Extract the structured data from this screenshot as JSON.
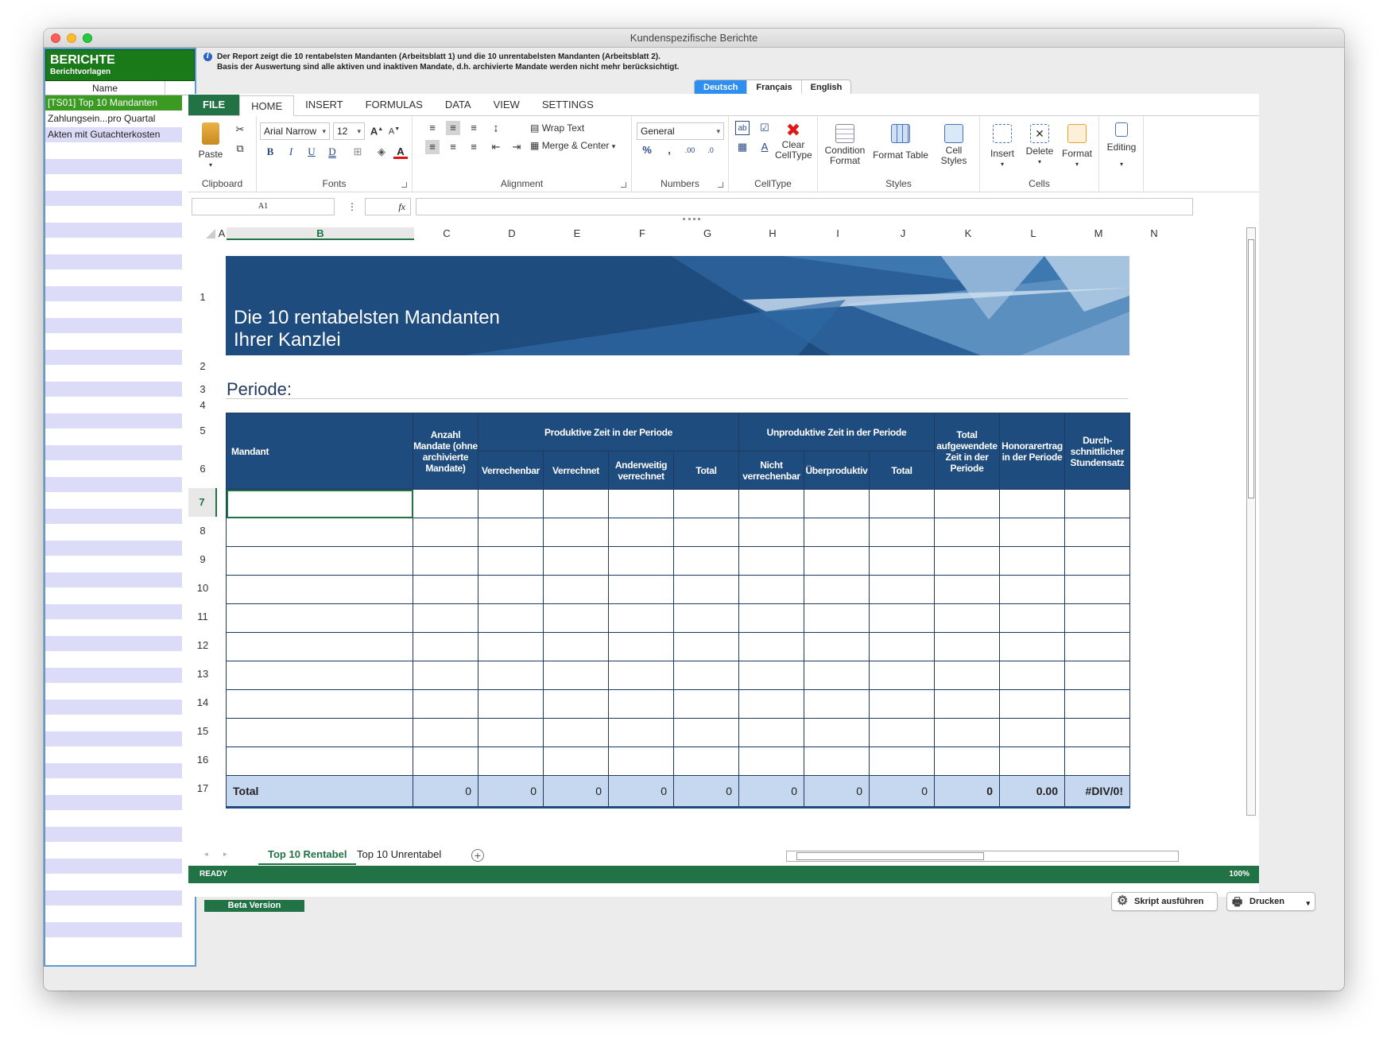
{
  "window": {
    "title": "Kundenspezifische Berichte"
  },
  "sidebar": {
    "title": "BERICHTE",
    "subtitle": "Berichtvorlagen",
    "column": "Name",
    "items": [
      "[TS01] Top 10 Mandanten",
      "Zahlungsein...pro Quartal",
      "Akten mit Gutachterkosten"
    ]
  },
  "info": {
    "line1": "Der Report zeigt die 10 rentabelsten Mandanten (Arbeitsblatt 1) und die 10 unrentabelsten Mandanten (Arbeitsblatt 2).",
    "line2": "Basis der Auswertung sind alle aktiven und inaktiven Mandate, d.h. archivierte Mandate werden nicht mehr berücksichtigt."
  },
  "languages": [
    "Deutsch",
    "Français",
    "English"
  ],
  "ribbon": {
    "tabs": [
      "FILE",
      "HOME",
      "INSERT",
      "FORMULAS",
      "DATA",
      "VIEW",
      "SETTINGS"
    ],
    "groups": {
      "clipboard": "Clipboard",
      "fonts": "Fonts",
      "alignment": "Alignment",
      "numbers": "Numbers",
      "celltype": "CellType",
      "styles": "Styles",
      "cells": "Cells"
    },
    "paste": "Paste",
    "font_name": "Arial Narrow",
    "font_size": "12",
    "wrap_text": "Wrap Text",
    "merge_center": "Merge & Center",
    "number_format": "General",
    "clear_celltype_1": "Clear",
    "clear_celltype_2": "CellType",
    "condition_format_1": "Condition",
    "condition_format_2": "Format",
    "format_table": "Format Table",
    "cell_styles_1": "Cell",
    "cell_styles_2": "Styles",
    "insert": "Insert",
    "delete": "Delete",
    "format": "Format",
    "editing": "Editing"
  },
  "formula_bar": {
    "name_box": "A1",
    "fx": "fx",
    "value": ""
  },
  "grid": {
    "columns": [
      "A",
      "B",
      "C",
      "D",
      "E",
      "F",
      "G",
      "H",
      "I",
      "J",
      "K",
      "L",
      "M",
      "N"
    ],
    "rows": [
      "1",
      "2",
      "3",
      "4",
      "5",
      "6",
      "7",
      "8",
      "9",
      "10",
      "11",
      "12",
      "13",
      "14",
      "15",
      "16",
      "17"
    ],
    "selected_column": "B",
    "selected_row": "7"
  },
  "report": {
    "banner_line1": "Die 10 rentabelsten Mandanten",
    "banner_line2": "Ihrer Kanzlei",
    "periode": "Periode:",
    "headers": {
      "mandant": "Mandant",
      "anzahl": "Anzahl Mandate (ohne archivierte Mandate)",
      "produktive": "Produktive Zeit in der Periode",
      "unproduktive": "Unproduktive Zeit in der Periode",
      "total_zeit": "Total aufgewendete Zeit in der Periode",
      "honorar": "Honorarertrag in der Periode",
      "stundensatz": "Durch-schnittlicher Stundensatz",
      "verrechenbar": "Verrechenbar",
      "verrechnet": "Verrechnet",
      "anderweitig": "Anderweitig verrechnet",
      "total": "Total",
      "nicht_verrechenbar": "Nicht verrechenbar",
      "ueberproduktiv": "Überproduktiv",
      "total2": "Total"
    },
    "total_row": {
      "label": "Total",
      "values": [
        "0",
        "0",
        "0",
        "0",
        "0",
        "0",
        "0",
        "0",
        "0",
        "0.00",
        "#DIV/0!"
      ]
    }
  },
  "sheets": [
    "Top 10 Rentabel",
    "Top 10 Unrentabel"
  ],
  "status": {
    "text": "READY",
    "zoom": "100%"
  },
  "footer": {
    "beta": "Beta Version",
    "run_script": "Skript ausführen",
    "print": "Drucken"
  }
}
